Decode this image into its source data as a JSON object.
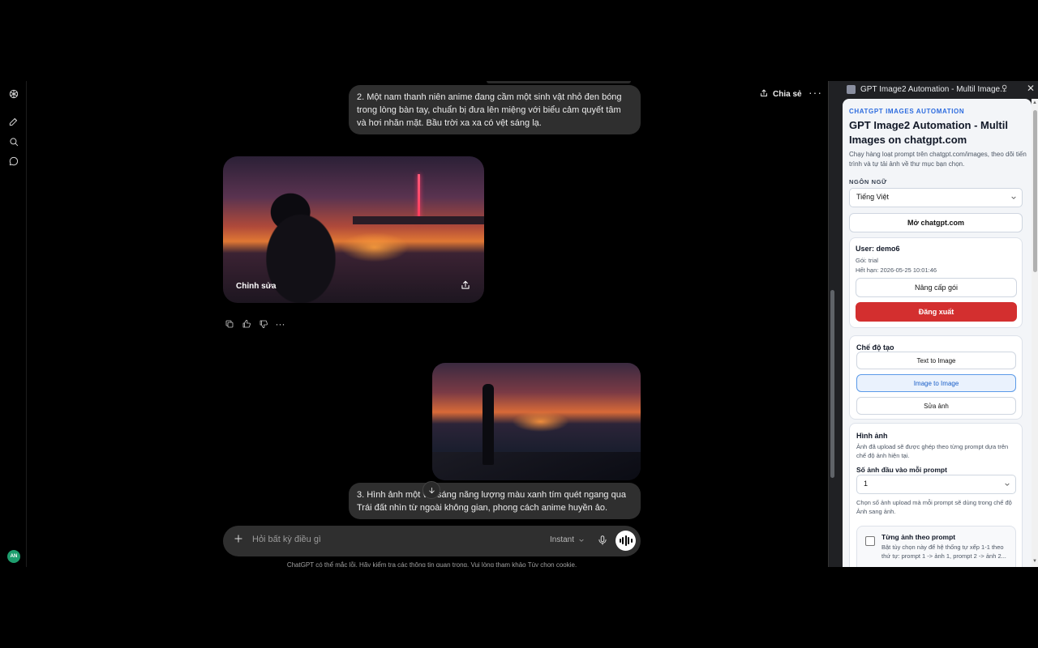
{
  "header": {
    "share_label": "Chia sẻ",
    "more_label": "···"
  },
  "rail": {
    "avatar_initials": "AN"
  },
  "chat": {
    "prompt_2": "2. Một nam thanh niên anime đang cầm một sinh vật nhỏ đen bóng trong lòng bàn tay, chuẩn bị đưa lên miệng với biểu cảm quyết tâm và hơi nhăn mặt. Bầu trời xa xa có vệt sáng lạ.",
    "image_edit_label": "Chỉnh sửa",
    "prompt_3": "3. Hình ảnh một vệt sáng năng lượng màu xanh tím quét ngang qua Trái đất nhìn từ ngoài không gian, phong cách anime huyền ảo.",
    "more_actions": "···"
  },
  "composer": {
    "placeholder": "Hỏi bất kỳ điều gì",
    "model_label": "Instant",
    "disclaimer": "ChatGPT có thể mắc lỗi. Hãy kiểm tra các thông tin quan trọng. Vui lòng tham khảo Tùy chọn cookie."
  },
  "panel": {
    "window_title": "GPT Image2 Automation - Multil Image...",
    "pin_glyph": "⚲",
    "close_glyph": "✕",
    "kicker": "CHATGPT IMAGES AUTOMATION",
    "title": "GPT Image2 Automation - Multil Images on chatgpt.com",
    "description": "Chạy hàng loạt prompt trên chatgpt.com/images, theo dõi tiến trình và tự tải ảnh về thư mục bạn chọn.",
    "language_label": "NGÔN NGỮ",
    "language_value": "Tiếng Việt",
    "open_button": "Mở chatgpt.com",
    "user": {
      "name": "User: demo6",
      "plan": "Gói: trial",
      "expiry": "Hết hạn: 2026-05-25 10:01:46",
      "upgrade_button": "Nâng cấp gói",
      "logout_button": "Đăng xuất"
    },
    "mode": {
      "title": "Chế độ tạo",
      "options": [
        "Text to Image",
        "Image to Image",
        "Sửa ảnh"
      ],
      "selected": "Image to Image"
    },
    "images": {
      "title": "Hình ảnh",
      "description": "Ảnh đã upload sẽ được ghép theo từng prompt dựa trên chế độ ảnh hiện tại.",
      "count_label": "Số ảnh đầu vào mỗi prompt",
      "count_value": "1",
      "count_hint": "Chọn số ảnh upload mà mỗi prompt sẽ dùng trong chế độ Ảnh sang ảnh.",
      "per_prompt_title": "Từng ảnh theo prompt",
      "per_prompt_desc": "Bật tùy chọn này để hệ thống tự xếp 1-1 theo thứ tự: prompt 1 -> ảnh 1, prompt 2 -> ảnh 2..."
    }
  }
}
